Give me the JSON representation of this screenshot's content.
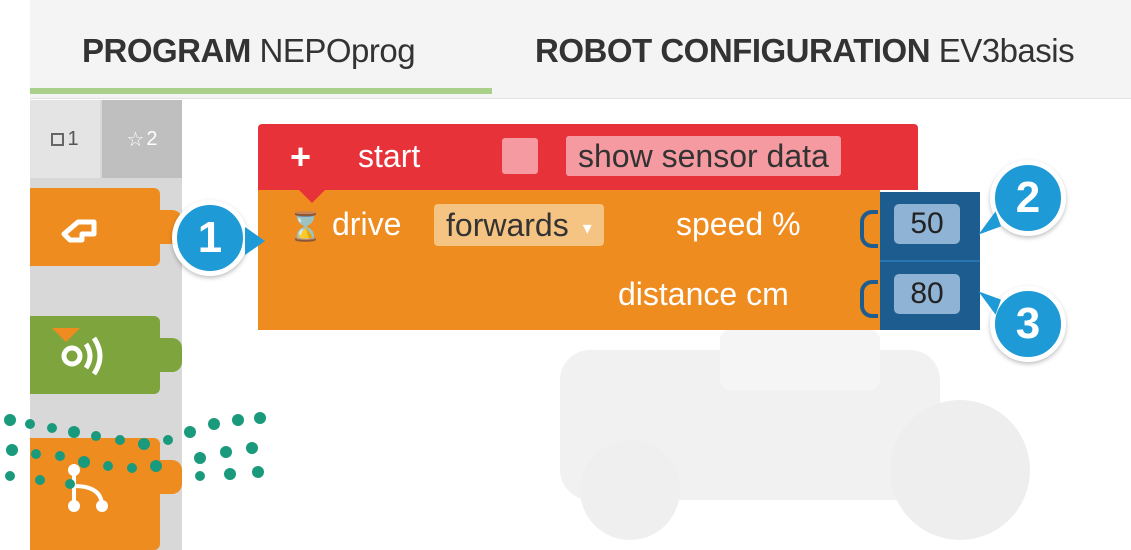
{
  "header": {
    "program_tab": {
      "bold": "PROGRAM",
      "name": "NEPOprog"
    },
    "robot_tab": {
      "bold": "ROBOT CONFIGURATION",
      "name": "EV3basis"
    }
  },
  "toolbox": {
    "levels": [
      {
        "label": "1",
        "icon": "square-icon"
      },
      {
        "label": "2",
        "icon": "star-icon"
      }
    ],
    "categories": [
      {
        "icon": "action-icon",
        "color": "#ef8c1f"
      },
      {
        "icon": "sensor-icon",
        "color": "#7da43d"
      },
      {
        "icon": "control-icon",
        "color": "#ef8c1f"
      }
    ]
  },
  "start_block": {
    "plus": "+",
    "label": "start",
    "checkbox_checked": false,
    "sensor_label": "show sensor data",
    "color": "#e8323a"
  },
  "drive_block": {
    "label": "drive",
    "direction": "forwards",
    "speed_label": "speed %",
    "distance_label": "distance cm",
    "speed_value": "50",
    "distance_value": "80",
    "color": "#ef8c1f"
  },
  "callouts": [
    "1",
    "2",
    "3"
  ],
  "colors": {
    "callout": "#1e9ad6",
    "number_block": "#1d5c8f",
    "dots": "#1a9a7c"
  }
}
